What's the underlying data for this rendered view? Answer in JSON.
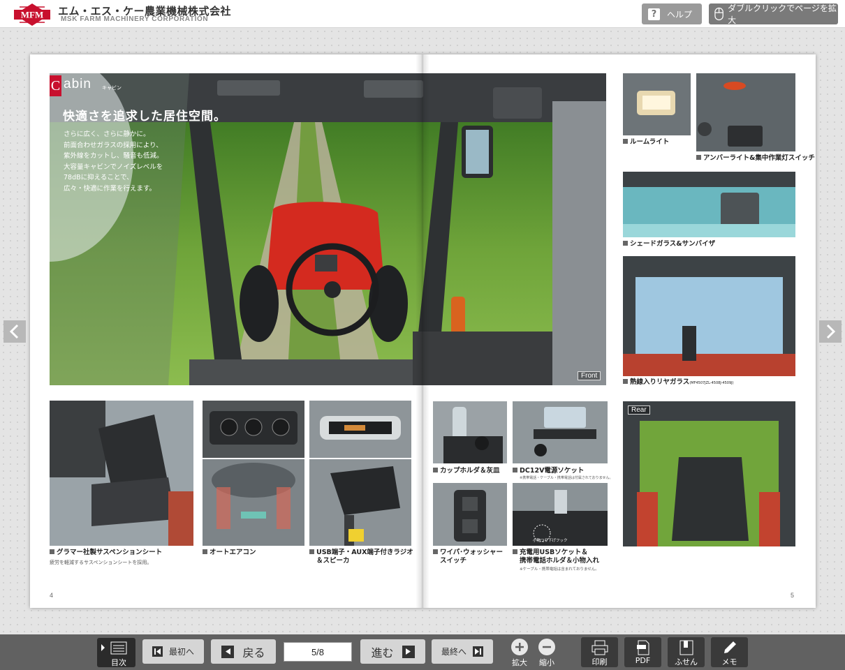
{
  "header": {
    "logo_text": "MFM",
    "company_jp": "エム・エス・ケー農業機械株式会社",
    "company_en": "MSK FARM MACHINERY CORPORATION",
    "help_label": "ヘルプ",
    "zoom_hint": "ダブルクリックでページを拡大"
  },
  "left_page": {
    "section_letter": "C",
    "section_word": "abin",
    "section_kana": "キャビン",
    "title": "快適さを追求した居住空間。",
    "body": "さらに広く、さらに静かに。\n前面合わせガラスの採用により、\n紫外線をカットし、騒音も低減。\n大容量キャビンでノイズレベルを\n78dBに抑えることで、\n広々・快適に作業を行えます。",
    "front_tag": "Front",
    "captions": {
      "seat": "グラマー社製サスペンションシート",
      "seat_sub": "疲労を軽減するサスペンションシートを採用。",
      "aircon": "オートエアコン",
      "radio_line1": "USB端子・AUX端子付きラジオ",
      "radio_line2": "＆スピーカ",
      "cupholder": "カップホルダ＆灰皿",
      "dc12v": "DC12V電源ソケット",
      "dc12v_sub": "※携帯電話・ケーブル・携帯電話は付属されておりません。",
      "wiper_line1": "ワイパ･ウォッシャー",
      "wiper_line2": "スイッチ",
      "usb_line1": "充電用USBソケット＆",
      "usb_line2": "携帯電話ホルダ＆小物入れ",
      "usb_sub": "※ケーブル・携帯電話は含まれておりません。",
      "hook_label": "小物つり下げフック"
    },
    "page_number": "4"
  },
  "right_page": {
    "captions": {
      "roomlight": "ルームライト",
      "amber": "アンバーライト&集中作業灯スイッチ",
      "shade": "シェードガラス&サンバイザ",
      "heated": "熱線入りリヤガラス",
      "heated_models": "(MF4507JZL-4508J-4509J)"
    },
    "rear_tag": "Rear",
    "page_number": "5"
  },
  "footer": {
    "toc_label": "目次",
    "first_label": "最初へ",
    "prev_label": "戻る",
    "page_value": "5/8",
    "next_label": "進む",
    "last_label": "最終へ",
    "zoom_in_label": "拡大",
    "zoom_out_label": "縮小",
    "print_label": "印刷",
    "pdf_label": "PDF",
    "sticky_label": "ふせん",
    "memo_label": "メモ"
  },
  "colors": {
    "brand_red": "#c8102e",
    "toolbar": "#616161",
    "button": "#d5d5d5"
  },
  "icons": [
    "help-icon",
    "mouse-icon",
    "chevron-left-icon",
    "chevron-right-icon",
    "toc-icon",
    "first-page-icon",
    "prev-icon",
    "next-icon",
    "last-page-icon",
    "zoom-in-icon",
    "zoom-out-icon",
    "print-icon",
    "pdf-icon",
    "sticky-note-icon",
    "memo-icon"
  ]
}
